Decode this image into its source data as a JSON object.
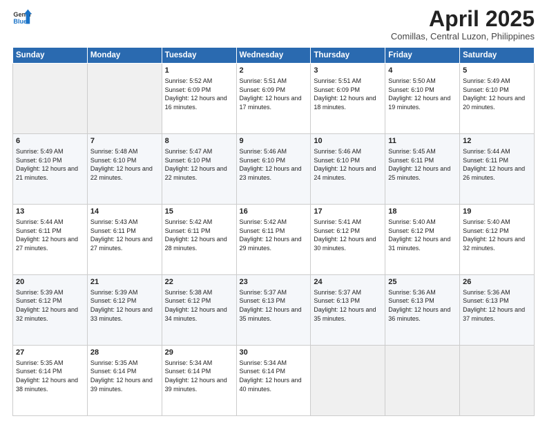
{
  "header": {
    "logo_general": "General",
    "logo_blue": "Blue",
    "month": "April 2025",
    "location": "Comillas, Central Luzon, Philippines"
  },
  "days_of_week": [
    "Sunday",
    "Monday",
    "Tuesday",
    "Wednesday",
    "Thursday",
    "Friday",
    "Saturday"
  ],
  "weeks": [
    [
      {
        "day": "",
        "info": ""
      },
      {
        "day": "",
        "info": ""
      },
      {
        "day": "1",
        "info": "Sunrise: 5:52 AM\nSunset: 6:09 PM\nDaylight: 12 hours and 16 minutes."
      },
      {
        "day": "2",
        "info": "Sunrise: 5:51 AM\nSunset: 6:09 PM\nDaylight: 12 hours and 17 minutes."
      },
      {
        "day": "3",
        "info": "Sunrise: 5:51 AM\nSunset: 6:09 PM\nDaylight: 12 hours and 18 minutes."
      },
      {
        "day": "4",
        "info": "Sunrise: 5:50 AM\nSunset: 6:10 PM\nDaylight: 12 hours and 19 minutes."
      },
      {
        "day": "5",
        "info": "Sunrise: 5:49 AM\nSunset: 6:10 PM\nDaylight: 12 hours and 20 minutes."
      }
    ],
    [
      {
        "day": "6",
        "info": "Sunrise: 5:49 AM\nSunset: 6:10 PM\nDaylight: 12 hours and 21 minutes."
      },
      {
        "day": "7",
        "info": "Sunrise: 5:48 AM\nSunset: 6:10 PM\nDaylight: 12 hours and 22 minutes."
      },
      {
        "day": "8",
        "info": "Sunrise: 5:47 AM\nSunset: 6:10 PM\nDaylight: 12 hours and 22 minutes."
      },
      {
        "day": "9",
        "info": "Sunrise: 5:46 AM\nSunset: 6:10 PM\nDaylight: 12 hours and 23 minutes."
      },
      {
        "day": "10",
        "info": "Sunrise: 5:46 AM\nSunset: 6:10 PM\nDaylight: 12 hours and 24 minutes."
      },
      {
        "day": "11",
        "info": "Sunrise: 5:45 AM\nSunset: 6:11 PM\nDaylight: 12 hours and 25 minutes."
      },
      {
        "day": "12",
        "info": "Sunrise: 5:44 AM\nSunset: 6:11 PM\nDaylight: 12 hours and 26 minutes."
      }
    ],
    [
      {
        "day": "13",
        "info": "Sunrise: 5:44 AM\nSunset: 6:11 PM\nDaylight: 12 hours and 27 minutes."
      },
      {
        "day": "14",
        "info": "Sunrise: 5:43 AM\nSunset: 6:11 PM\nDaylight: 12 hours and 27 minutes."
      },
      {
        "day": "15",
        "info": "Sunrise: 5:42 AM\nSunset: 6:11 PM\nDaylight: 12 hours and 28 minutes."
      },
      {
        "day": "16",
        "info": "Sunrise: 5:42 AM\nSunset: 6:11 PM\nDaylight: 12 hours and 29 minutes."
      },
      {
        "day": "17",
        "info": "Sunrise: 5:41 AM\nSunset: 6:12 PM\nDaylight: 12 hours and 30 minutes."
      },
      {
        "day": "18",
        "info": "Sunrise: 5:40 AM\nSunset: 6:12 PM\nDaylight: 12 hours and 31 minutes."
      },
      {
        "day": "19",
        "info": "Sunrise: 5:40 AM\nSunset: 6:12 PM\nDaylight: 12 hours and 32 minutes."
      }
    ],
    [
      {
        "day": "20",
        "info": "Sunrise: 5:39 AM\nSunset: 6:12 PM\nDaylight: 12 hours and 32 minutes."
      },
      {
        "day": "21",
        "info": "Sunrise: 5:39 AM\nSunset: 6:12 PM\nDaylight: 12 hours and 33 minutes."
      },
      {
        "day": "22",
        "info": "Sunrise: 5:38 AM\nSunset: 6:12 PM\nDaylight: 12 hours and 34 minutes."
      },
      {
        "day": "23",
        "info": "Sunrise: 5:37 AM\nSunset: 6:13 PM\nDaylight: 12 hours and 35 minutes."
      },
      {
        "day": "24",
        "info": "Sunrise: 5:37 AM\nSunset: 6:13 PM\nDaylight: 12 hours and 35 minutes."
      },
      {
        "day": "25",
        "info": "Sunrise: 5:36 AM\nSunset: 6:13 PM\nDaylight: 12 hours and 36 minutes."
      },
      {
        "day": "26",
        "info": "Sunrise: 5:36 AM\nSunset: 6:13 PM\nDaylight: 12 hours and 37 minutes."
      }
    ],
    [
      {
        "day": "27",
        "info": "Sunrise: 5:35 AM\nSunset: 6:14 PM\nDaylight: 12 hours and 38 minutes."
      },
      {
        "day": "28",
        "info": "Sunrise: 5:35 AM\nSunset: 6:14 PM\nDaylight: 12 hours and 39 minutes."
      },
      {
        "day": "29",
        "info": "Sunrise: 5:34 AM\nSunset: 6:14 PM\nDaylight: 12 hours and 39 minutes."
      },
      {
        "day": "30",
        "info": "Sunrise: 5:34 AM\nSunset: 6:14 PM\nDaylight: 12 hours and 40 minutes."
      },
      {
        "day": "",
        "info": ""
      },
      {
        "day": "",
        "info": ""
      },
      {
        "day": "",
        "info": ""
      }
    ]
  ]
}
